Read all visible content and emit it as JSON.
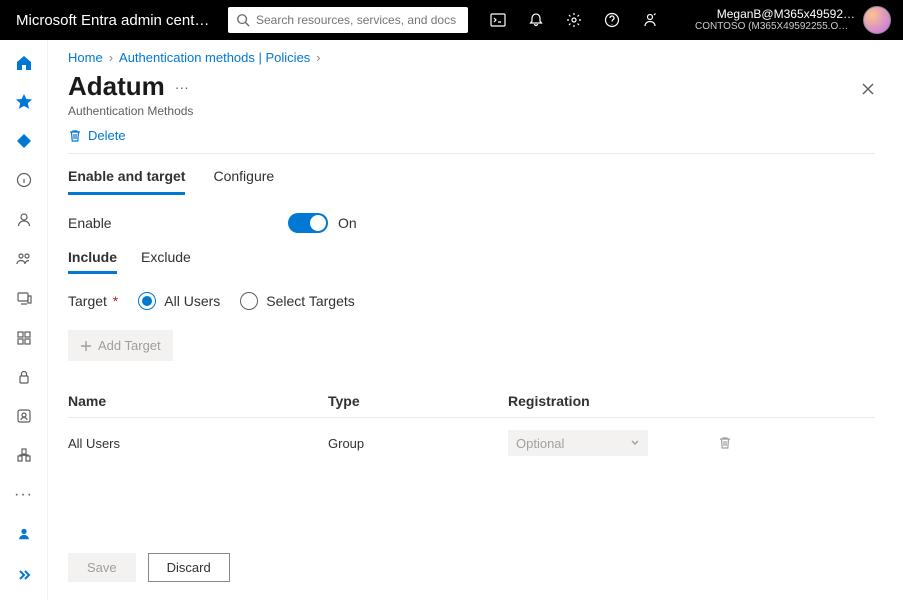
{
  "header": {
    "brand": "Microsoft Entra admin cent…",
    "search_placeholder": "Search resources, services, and docs (G+/)",
    "account_line1": "MeganB@M365x49592…",
    "account_line2": "CONTOSO (M365X49592255.ON…"
  },
  "breadcrumb": {
    "items": [
      "Home",
      "Authentication methods | Policies"
    ]
  },
  "page": {
    "title": "Adatum",
    "subtitle": "Authentication Methods",
    "delete_label": "Delete"
  },
  "tabs": {
    "t1": "Enable and target",
    "t2": "Configure"
  },
  "enable": {
    "label": "Enable",
    "state": "On"
  },
  "subtabs": {
    "t1": "Include",
    "t2": "Exclude"
  },
  "target": {
    "label": "Target",
    "opt1": "All Users",
    "opt2": "Select Targets"
  },
  "add_target_label": "Add Target",
  "table": {
    "head": {
      "name": "Name",
      "type": "Type",
      "reg": "Registration"
    },
    "rows": [
      {
        "name": "All Users",
        "type": "Group",
        "reg": "Optional"
      }
    ]
  },
  "footer": {
    "save": "Save",
    "discard": "Discard"
  }
}
